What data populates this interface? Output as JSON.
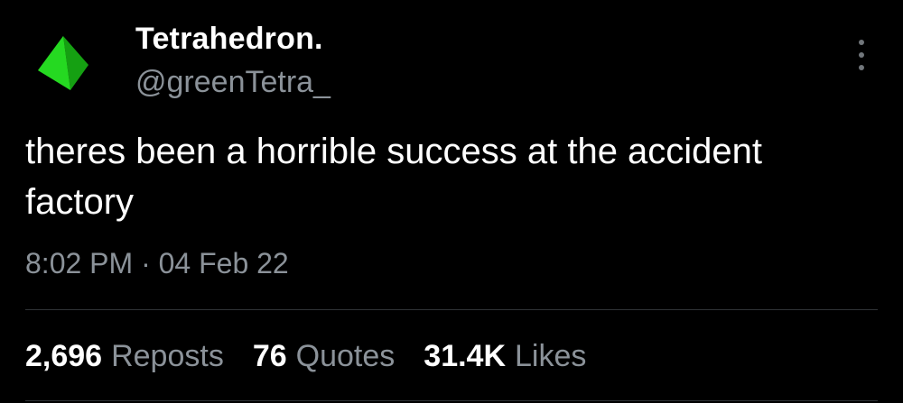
{
  "author": {
    "display_name": "Tetrahedron.",
    "handle": "@greenTetra_",
    "avatar_color": "#22d61f"
  },
  "tweet": {
    "text": "theres been a horrible success at the accident\nfactory",
    "time": "8:02 PM",
    "separator": "·",
    "date": "04 Feb 22"
  },
  "stats": {
    "reposts_count": "2,696",
    "reposts_label": "Reposts",
    "quotes_count": "76",
    "quotes_label": "Quotes",
    "likes_count": "31.4K",
    "likes_label": "Likes"
  },
  "colors": {
    "background": "#000000",
    "text_primary": "#ffffff",
    "text_secondary": "#8b9299",
    "divider": "#2f3336"
  },
  "icons": {
    "more": "more-vertical-icon"
  }
}
